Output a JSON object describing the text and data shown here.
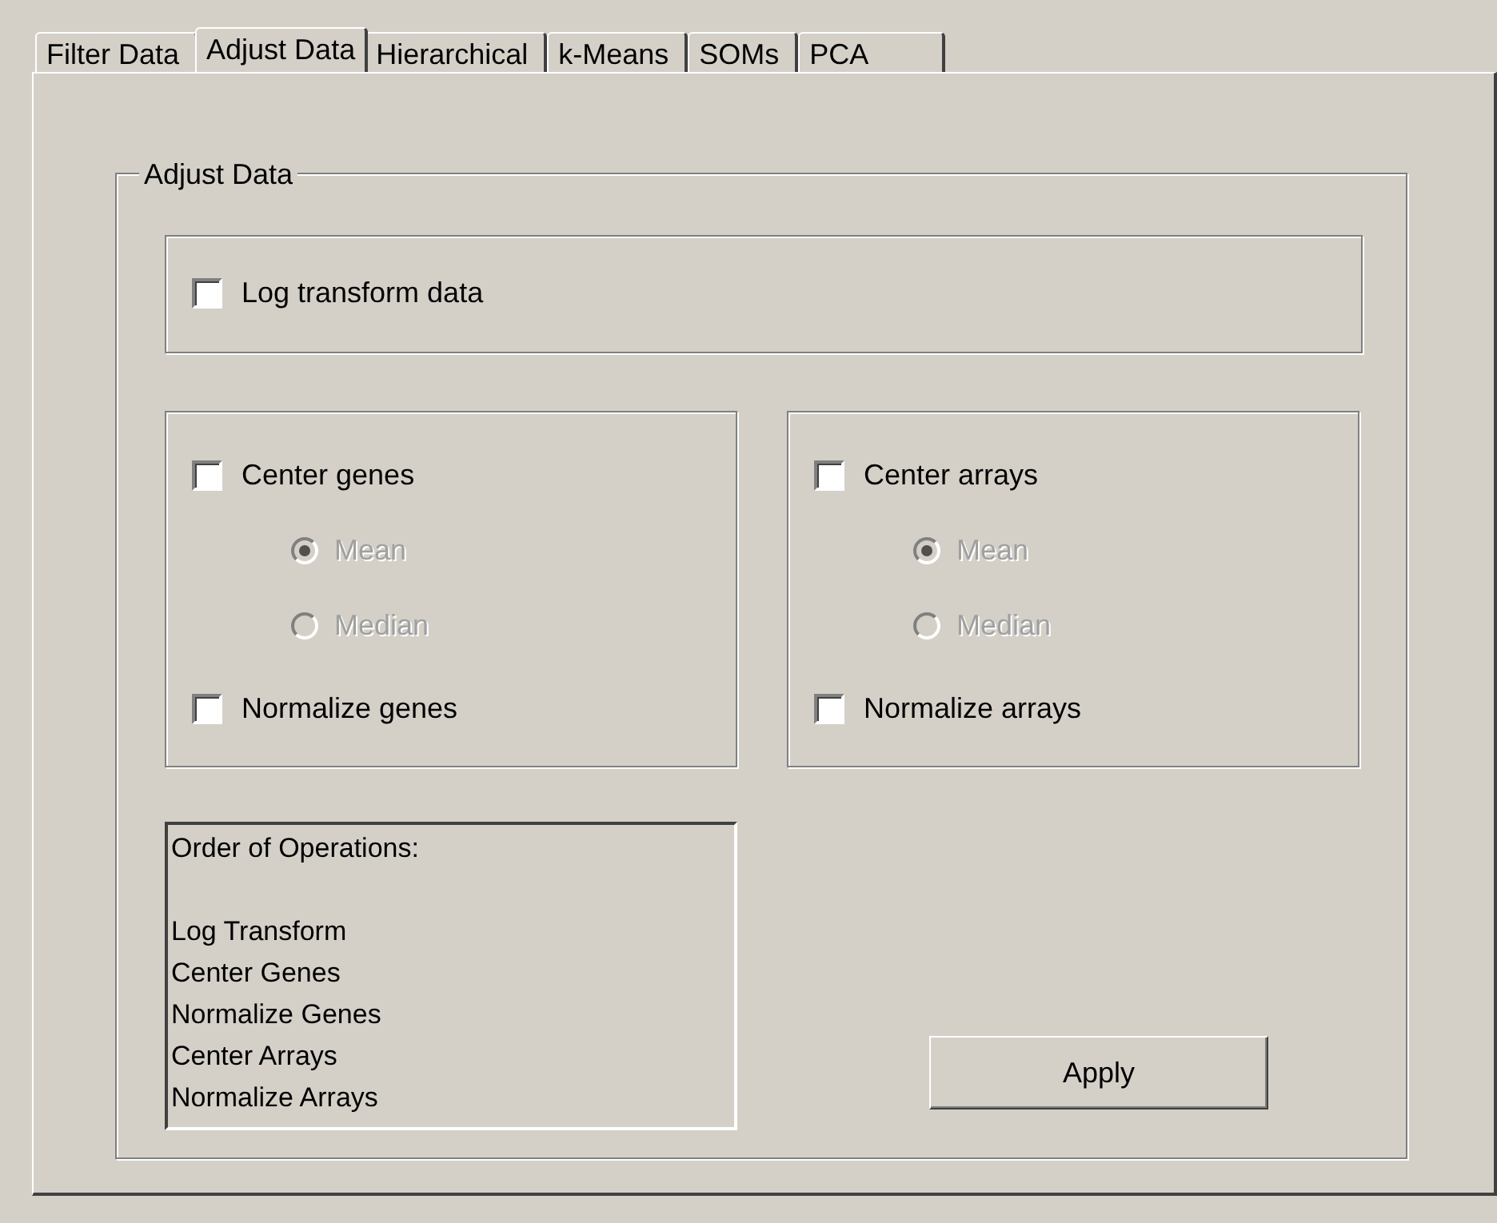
{
  "tabs": [
    {
      "label": "Filter Data",
      "selected": false
    },
    {
      "label": "Adjust Data",
      "selected": true
    },
    {
      "label": "Hierarchical",
      "selected": false
    },
    {
      "label": "k-Means",
      "selected": false
    },
    {
      "label": "SOMs",
      "selected": false
    },
    {
      "label": "PCA",
      "selected": false
    }
  ],
  "group": {
    "title": "Adjust Data"
  },
  "log_transform": {
    "label": "Log transform data",
    "checked": false
  },
  "panels": [
    {
      "center": {
        "label": "Center genes",
        "checked": false
      },
      "methods": [
        {
          "label": "Mean",
          "selected": true,
          "disabled": true
        },
        {
          "label": "Median",
          "selected": false,
          "disabled": true
        }
      ],
      "normalize": {
        "label": "Normalize genes",
        "checked": false
      }
    },
    {
      "center": {
        "label": "Center arrays",
        "checked": false
      },
      "methods": [
        {
          "label": "Mean",
          "selected": true,
          "disabled": true
        },
        {
          "label": "Median",
          "selected": false,
          "disabled": true
        }
      ],
      "normalize": {
        "label": "Normalize arrays",
        "checked": false
      }
    }
  ],
  "order": {
    "title": "Order of Operations:",
    "steps": [
      "Log Transform",
      "Center Genes",
      "Normalize Genes",
      "Center Arrays",
      "Normalize Arrays"
    ]
  },
  "apply_button": "Apply"
}
